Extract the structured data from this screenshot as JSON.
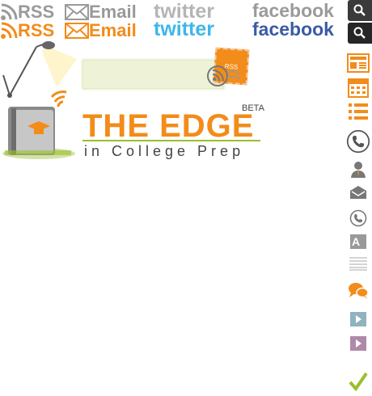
{
  "header": {
    "rss_label": "RSS",
    "email_label": "Email",
    "twitter_label": "twitter",
    "facebook_label": "facebook"
  },
  "logo": {
    "title": "THE EDGE",
    "beta": "BETA",
    "subtitle": "in College Prep"
  },
  "rss_stamp": "RSS",
  "colors": {
    "accent": "#f28c1a",
    "facebook": "#3a5ba5",
    "twitter": "#3fb7e8",
    "green": "#9bbf2c"
  },
  "sidebar_icons": [
    "news-icon",
    "calendar-icon",
    "list-icon",
    "phone-icon",
    "user-icon",
    "mail-icon",
    "phone-small-icon",
    "font-size-icon",
    "lines-icon",
    "chat-icon",
    "play-teal-icon",
    "play-purple-icon",
    "checkmark-icon"
  ]
}
